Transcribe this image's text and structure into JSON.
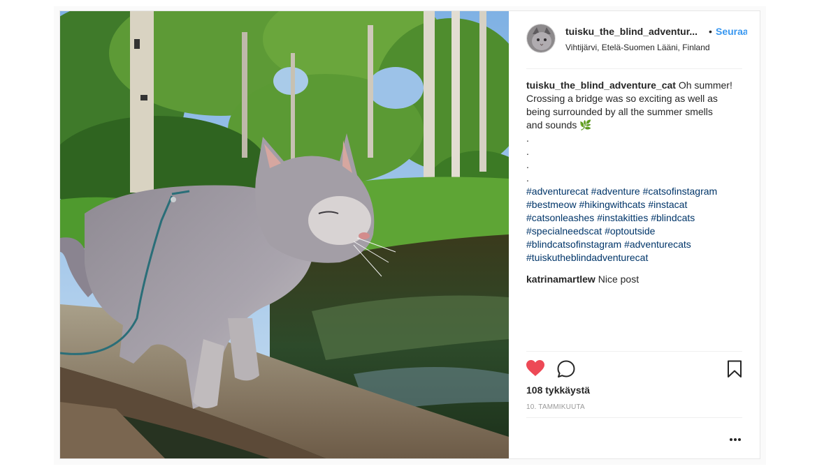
{
  "post": {
    "username": "tuisku_the_blind_adventure_cat",
    "username_display": "tuisku_the_blind_adventur...",
    "separator": "•",
    "follow_label": "Seuraa",
    "location": "Vihtijärvi, Etelä-Suomen Lääni, Finland",
    "caption": {
      "username": "tuisku_the_blind_adventure_cat",
      "lines": [
        "Oh summer!",
        "Crossing a bridge was so exciting as well as",
        "being surrounded by all the summer smells",
        "and sounds 🌿"
      ],
      "dots": [
        ".",
        ".",
        ".",
        "."
      ],
      "hashtag_lines": [
        [
          "#adventurecat",
          "#adventure",
          "#catsofinstagram"
        ],
        [
          "#bestmeow",
          "#hikingwithcats",
          "#instacat"
        ],
        [
          "#catsonleashes",
          "#instakitties",
          "#blindcats"
        ],
        [
          "#specialneedscat",
          "#optoutside"
        ],
        [
          "#blindcatsofinstagram",
          "#adventurecats"
        ],
        [
          "#tuiskutheblindadventurecat"
        ]
      ]
    },
    "comments": [
      {
        "username": "katrinamartlew",
        "text": "Nice post"
      }
    ],
    "likes_text": "108 tykkäystä",
    "date_text": "10. TAMMIKUUTA",
    "liked": true,
    "colors": {
      "like_red": "#ed4956",
      "follow_blue": "#3897f0",
      "hashtag_blue": "#003569",
      "text": "#262626",
      "muted": "#999999"
    },
    "icons": {
      "like": "heart-icon",
      "comment": "comment-bubble-icon",
      "save": "bookmark-icon",
      "more": "more-options-icon"
    }
  }
}
